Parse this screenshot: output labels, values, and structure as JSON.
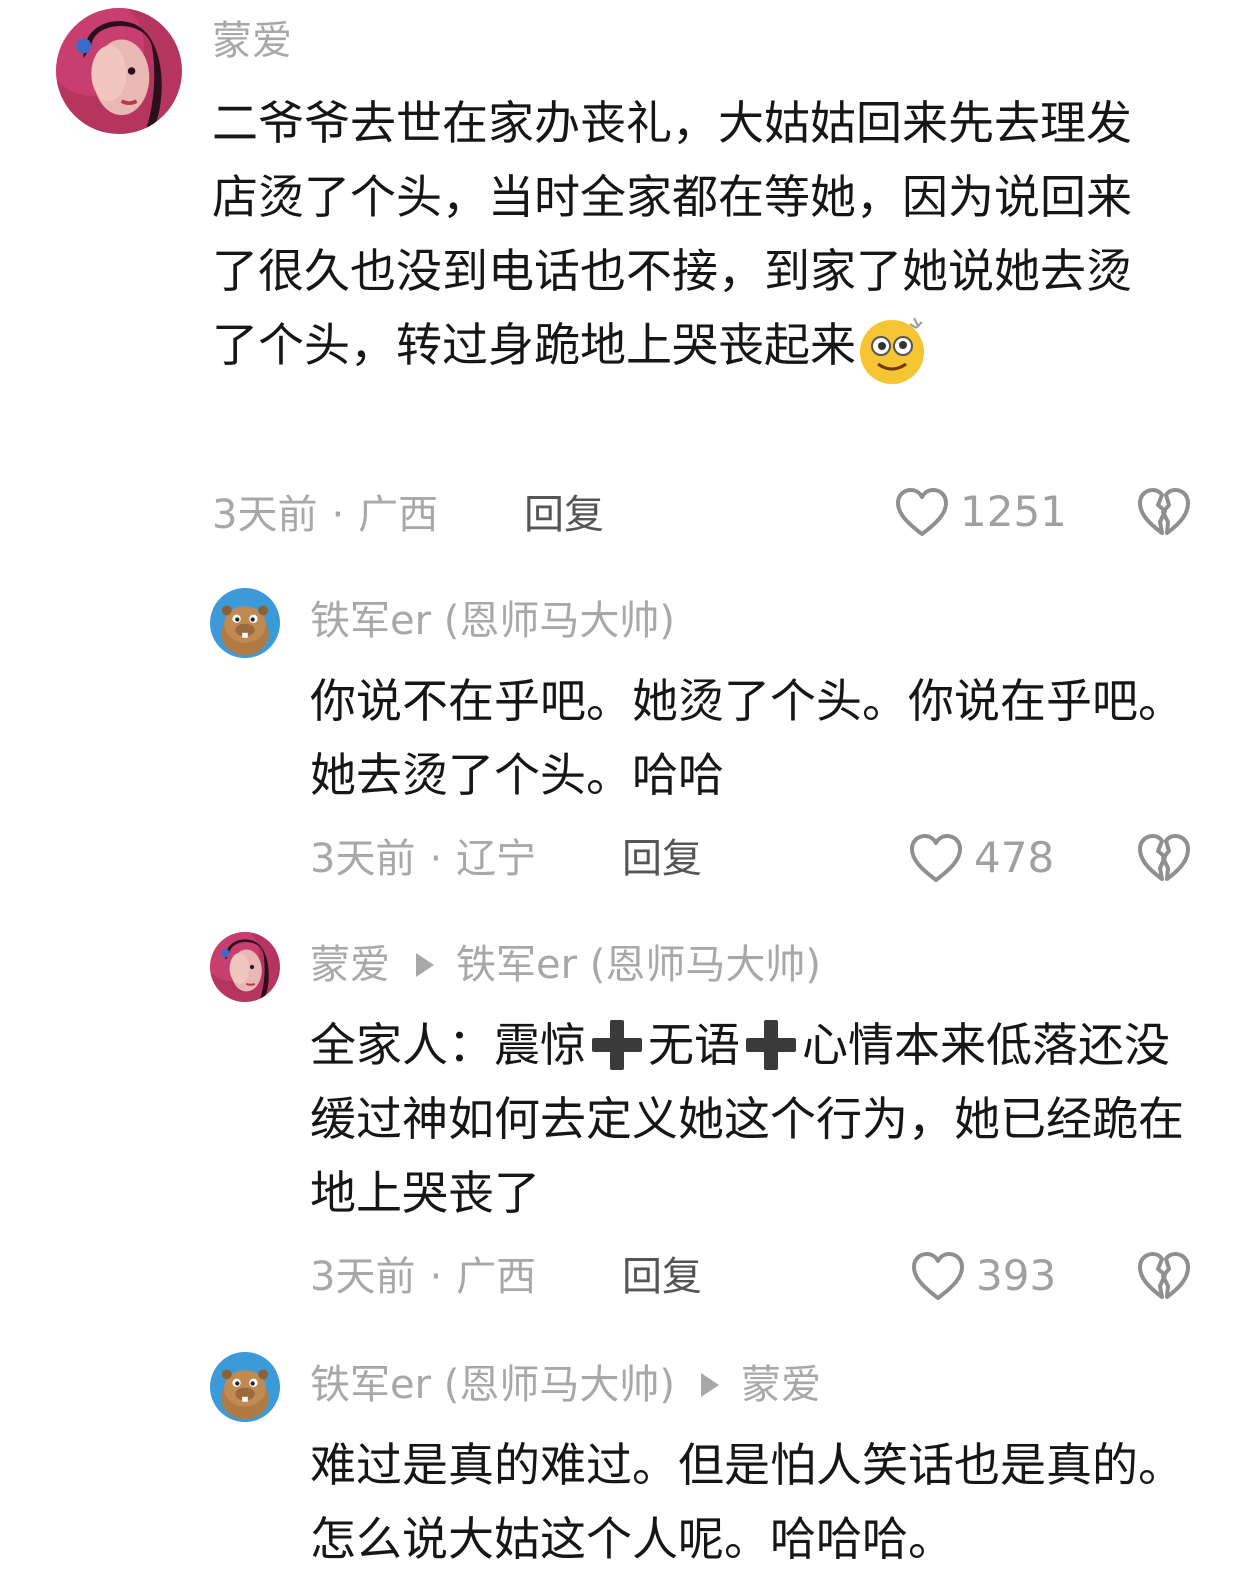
{
  "comments": [
    {
      "user": "蒙爱",
      "text": "二爷爷去世在家办丧礼，大姑姑回来先去理发店烫了个头，当时全家都在等她，因为说回来了很久也没到电话也不接，到家了她说她去烫了个头，转过身跪地上哭丧起来",
      "emoji": "dizzy-face-emoji",
      "time": "3天前",
      "location": "广西",
      "reply_label": "回复",
      "likes": "1251"
    },
    {
      "user": "铁军er (恩师马大帅)",
      "text": "你说不在乎吧。她烫了个头。你说在乎吧。她去烫了个头。哈哈",
      "time": "3天前",
      "location": "辽宁",
      "reply_label": "回复",
      "likes": "478"
    },
    {
      "user": "蒙爱",
      "reply_to": "铁军er (恩师马大帅)",
      "text_parts": [
        "全家人：震惊",
        "无语",
        "心情本来低落还没缓过神如何去定义她这个行为，她已经跪在地上哭丧了"
      ],
      "time": "3天前",
      "location": "广西",
      "reply_label": "回复",
      "likes": "393"
    },
    {
      "user": "铁军er (恩师马大帅)",
      "reply_to": "蒙爱",
      "text": "难过是真的难过。但是怕人笑话也是真的。怎么说大姑这个人呢。哈哈哈。"
    }
  ],
  "separator": "·",
  "colors": {
    "meta_gray": "#a8a8a8",
    "text": "#161616",
    "reply": "#555555"
  }
}
